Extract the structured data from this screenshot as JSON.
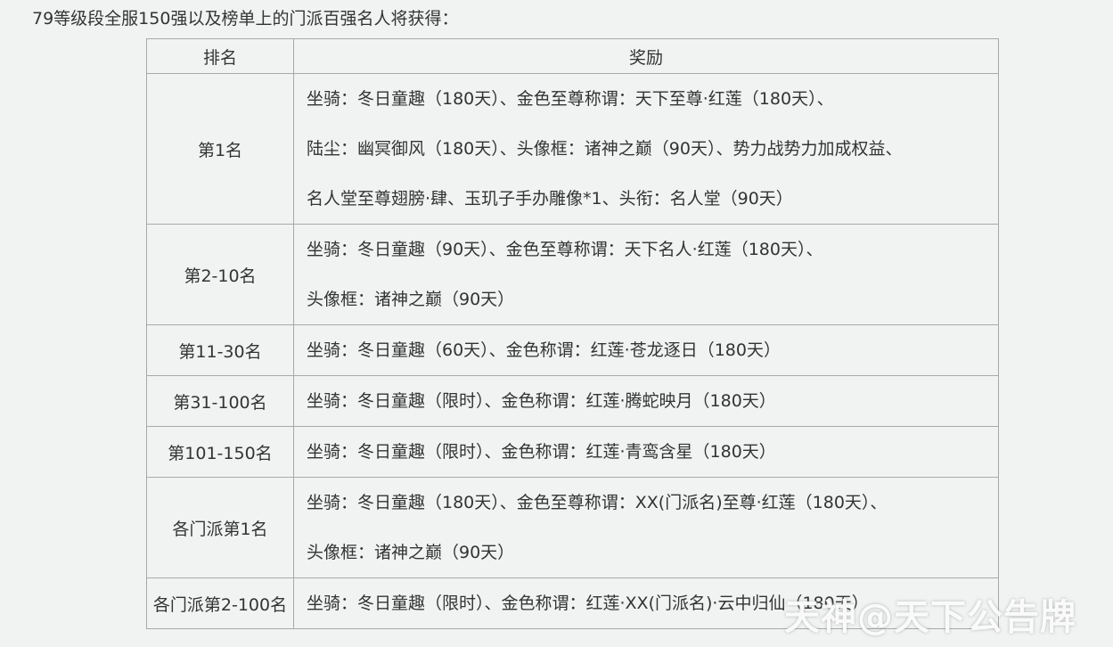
{
  "intro": "79等级段全服150强以及榜单上的门派百强名人将获得：",
  "table": {
    "headers": [
      "排名",
      "奖励"
    ],
    "rows": [
      {
        "rank": "第1名",
        "lines": [
          "坐骑：冬日童趣（180天）、金色至尊称谓：天下至尊·红莲（180天）、",
          "陆尘：幽冥御风（180天）、头像框：诸神之巅（90天）、势力战势力加成权益、",
          "名人堂至尊翅膀·肆、玉玑子手办雕像*1、头衔：名人堂（90天）"
        ]
      },
      {
        "rank": "第2-10名",
        "lines": [
          "坐骑：冬日童趣（90天）、金色至尊称谓：天下名人·红莲（180天）、",
          "头像框：诸神之巅（90天）"
        ]
      },
      {
        "rank": "第11-30名",
        "lines": [
          "坐骑：冬日童趣（60天）、金色称谓：红莲·苍龙逐日（180天）"
        ]
      },
      {
        "rank": "第31-100名",
        "lines": [
          "坐骑：冬日童趣（限时）、金色称谓：红莲·腾蛇映月（180天）"
        ]
      },
      {
        "rank": "第101-150名",
        "lines": [
          "坐骑：冬日童趣（限时）、金色称谓：红莲·青鸾含星（180天）"
        ]
      },
      {
        "rank": "各门派第1名",
        "lines": [
          "坐骑：冬日童趣（180天）、金色至尊称谓：XX(门派名)至尊·红莲（180天）、",
          "头像框：诸神之巅（90天）"
        ]
      },
      {
        "rank": "各门派第2-100名",
        "lines": [
          "坐骑：冬日童趣（限时）、金色称谓：红莲·XX(门派名)·云中归仙（180天）"
        ]
      }
    ]
  },
  "watermark": "天神@天下公告牌"
}
